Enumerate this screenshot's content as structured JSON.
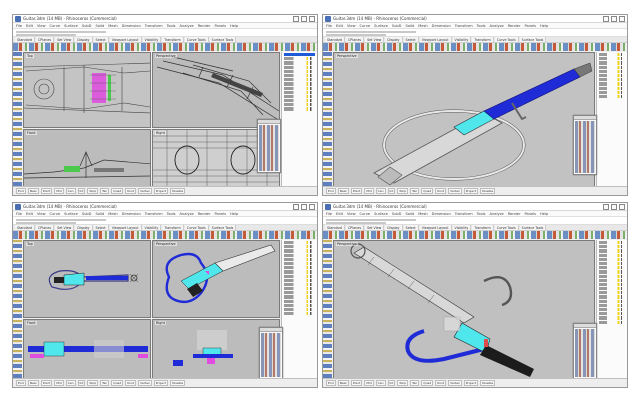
{
  "windows": [
    {
      "title": "Guitar.3dm (14 MB) - Rhinoceros (Commercial)",
      "menu": [
        "File",
        "Edit",
        "View",
        "Curve",
        "Surface",
        "SubD",
        "Solid",
        "Mesh",
        "Dimension",
        "Transform",
        "Tools",
        "Analyze",
        "Render",
        "Panels",
        "Help"
      ],
      "tabs": [
        "Standard",
        "CPlanes",
        "Set View",
        "Display",
        "Select",
        "Viewport Layout",
        "Visibility",
        "Transform",
        "Curve Tools",
        "Surface Tools",
        "Solid Tools",
        "SubD Tools",
        "Mesh Tools",
        "Render Tools",
        "Drafting",
        "New in V7"
      ],
      "viewports": [
        "Top",
        "Perspective",
        "Front",
        "Right"
      ],
      "osnaps": [
        "End",
        "Near",
        "Point",
        "Mid",
        "Cen",
        "Int",
        "Perp",
        "Tan",
        "Quad",
        "Knot",
        "Vertex",
        "Project",
        "Disable"
      ]
    },
    {
      "title": "Guitar.3dm (14 MB) - Rhinoceros (Commercial)",
      "menu": [
        "File",
        "Edit",
        "View",
        "Curve",
        "Surface",
        "SubD",
        "Solid",
        "Mesh",
        "Dimension",
        "Transform",
        "Tools",
        "Analyze",
        "Render",
        "Panels",
        "Help"
      ],
      "tabs": [
        "Standard",
        "CPlanes",
        "Set View",
        "Display",
        "Select",
        "Viewport Layout",
        "Visibility",
        "Transform",
        "Curve Tools",
        "Surface Tools",
        "Solid Tools",
        "SubD Tools",
        "Mesh Tools",
        "Render Tools",
        "Drafting",
        "New in V7"
      ],
      "viewports": [
        "Perspective"
      ],
      "osnaps": [
        "End",
        "Near",
        "Point",
        "Mid",
        "Cen",
        "Int",
        "Perp",
        "Tan",
        "Quad",
        "Knot",
        "Vertex",
        "Project",
        "Disable"
      ]
    },
    {
      "title": "Guitar.3dm (14 MB) - Rhinoceros (Commercial)",
      "menu": [
        "File",
        "Edit",
        "View",
        "Curve",
        "Surface",
        "SubD",
        "Solid",
        "Mesh",
        "Dimension",
        "Transform",
        "Tools",
        "Analyze",
        "Render",
        "Panels",
        "Help"
      ],
      "tabs": [
        "Standard",
        "CPlanes",
        "Set View",
        "Display",
        "Select",
        "Viewport Layout",
        "Visibility",
        "Transform",
        "Curve Tools",
        "Surface Tools",
        "Solid Tools",
        "SubD Tools",
        "Mesh Tools",
        "Render Tools",
        "Drafting",
        "New in V7"
      ],
      "viewports": [
        "Top",
        "Perspective",
        "Front",
        "Right"
      ],
      "osnaps": [
        "End",
        "Near",
        "Point",
        "Mid",
        "Cen",
        "Int",
        "Perp",
        "Tan",
        "Quad",
        "Knot",
        "Vertex",
        "Project",
        "Disable"
      ]
    },
    {
      "title": "Guitar.3dm (14 MB) - Rhinoceros (Commercial)",
      "menu": [
        "File",
        "Edit",
        "View",
        "Curve",
        "Surface",
        "SubD",
        "Solid",
        "Mesh",
        "Dimension",
        "Transform",
        "Tools",
        "Analyze",
        "Render",
        "Panels",
        "Help"
      ],
      "tabs": [
        "Standard",
        "CPlanes",
        "Set View",
        "Display",
        "Select",
        "Viewport Layout",
        "Visibility",
        "Transform",
        "Curve Tools",
        "Surface Tools",
        "Solid Tools",
        "SubD Tools",
        "Mesh Tools",
        "Render Tools",
        "Drafting",
        "New in V7"
      ],
      "viewports": [
        "Perspective"
      ],
      "osnaps": [
        "End",
        "Near",
        "Point",
        "Mid",
        "Cen",
        "Int",
        "Perp",
        "Tan",
        "Quad",
        "Knot",
        "Vertex",
        "Project",
        "Disable"
      ]
    }
  ],
  "colors": {
    "viewport_bg": "#bcbcbc",
    "neck_blue": "#1f2bd6",
    "body_cyan": "#4fe6ec",
    "highlight_magenta": "#e04be0",
    "layer_yellow": "#f2d21a"
  },
  "icons": [
    "rhino-logo-icon",
    "minimize-icon",
    "maximize-icon",
    "close-icon"
  ]
}
